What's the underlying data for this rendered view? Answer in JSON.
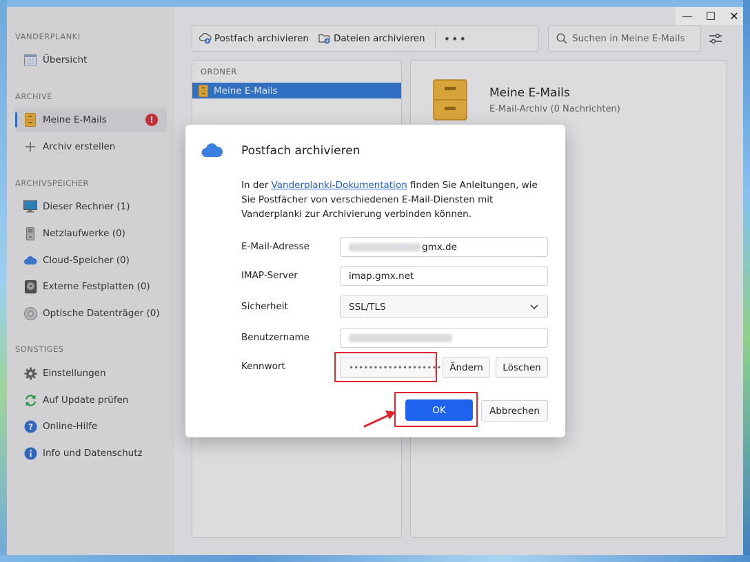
{
  "window": {
    "controls": {
      "minimize": "—",
      "maximize": "☐",
      "close": "✕"
    }
  },
  "sidebar": {
    "sections": [
      {
        "label": "VANDERPLANKI"
      },
      {
        "label": "ARCHIVE"
      },
      {
        "label": "ARCHIVSPEICHER"
      },
      {
        "label": "SONSTIGES"
      }
    ],
    "items": [
      {
        "label": "Übersicht",
        "icon": "calendar-icon"
      },
      {
        "label": "Meine E-Mails",
        "icon": "cabinet-icon",
        "badge": "!"
      },
      {
        "label": "Archiv erstellen",
        "icon": "plus-icon"
      },
      {
        "label": "Dieser Rechner (1)",
        "icon": "monitor-icon"
      },
      {
        "label": "Netzlaufwerke (0)",
        "icon": "server-icon"
      },
      {
        "label": "Cloud-Speicher (0)",
        "icon": "cloud-icon"
      },
      {
        "label": "Externe Festplatten (0)",
        "icon": "harddisk-icon"
      },
      {
        "label": "Optische Datenträger (0)",
        "icon": "disc-icon"
      },
      {
        "label": "Einstellungen",
        "icon": "gear-icon"
      },
      {
        "label": "Auf Update prüfen",
        "icon": "refresh-icon"
      },
      {
        "label": "Online-Hilfe",
        "icon": "help-icon"
      },
      {
        "label": "Info und Datenschutz",
        "icon": "info-icon"
      }
    ]
  },
  "toolbar": {
    "archive_mailbox": "Postfach archivieren",
    "archive_files": "Dateien archivieren",
    "more": "•••"
  },
  "search": {
    "placeholder": "Suchen in Meine E-Mails"
  },
  "folders": {
    "header": "ORDNER",
    "items": [
      {
        "label": "Meine E-Mails"
      }
    ]
  },
  "detail": {
    "title": "Meine E-Mails",
    "subtitle": "E-Mail-Archiv (0 Nachrichten)"
  },
  "dialog": {
    "title": "Postfach archivieren",
    "text_before": "In der ",
    "link": "Vanderplanki-Dokumentation",
    "text_after": " finden Sie Anleitungen, wie Sie Postfächer von verschiedenen E-Mail-Diensten mit Vanderplanki zur Archivierung verbinden können.",
    "email_label": "E-Mail-Adresse",
    "email_suffix": "gmx.de",
    "imap_label": "IMAP-Server",
    "imap_value": "imap.gmx.net",
    "security_label": "Sicherheit",
    "security_value": "SSL/TLS",
    "username_label": "Benutzername",
    "password_label": "Kennwort",
    "password_mask": "••••••••••••••••••••",
    "change_button": "Ändern",
    "delete_button": "Löschen",
    "ok_button": "OK",
    "cancel_button": "Abbrechen"
  },
  "colors": {
    "accent": "#1e63f0",
    "selection": "#2f78d6",
    "highlight": "#e0242d",
    "badge": "#d9303a"
  }
}
